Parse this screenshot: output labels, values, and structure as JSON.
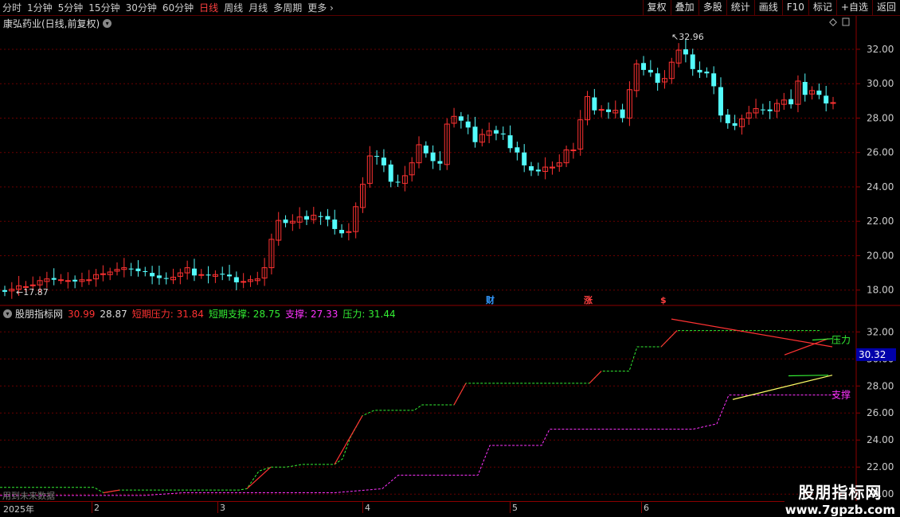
{
  "toolbar": {
    "timeframes": [
      "分时",
      "1分钟",
      "5分钟",
      "15分钟",
      "30分钟",
      "60分钟",
      "日线",
      "周线",
      "月线",
      "多周期",
      "更多"
    ],
    "active_index": 6,
    "right_buttons": [
      "复权",
      "叠加",
      "多股",
      "统计",
      "画线",
      "F10",
      "标记",
      "+自选",
      "返回"
    ]
  },
  "stock": {
    "title": "康弘药业(日线,前复权)"
  },
  "price_chart": {
    "ylabels": [
      "32.00",
      "30.00",
      "28.00",
      "26.00",
      "24.00",
      "22.00",
      "20.00",
      "18.00"
    ],
    "high_label": "32.96",
    "low_label": "17.87",
    "events": [
      "财",
      "涨",
      "$"
    ]
  },
  "indicator": {
    "name": "股朋指标网",
    "v1": "30.99",
    "v2": "28.87",
    "short_resist": "短期压力: 31.84",
    "short_support": "短期支撑: 28.75",
    "support": "支撑: 27.33",
    "resist": "压力: 31.44",
    "ylabels": [
      "32.00",
      "30.00",
      "28.00",
      "26.00",
      "24.00",
      "22.00",
      "20.00"
    ],
    "current": "30.32",
    "label_resist": "压力",
    "label_support": "支撑"
  },
  "dates": [
    "2025年",
    "2",
    "3",
    "4",
    "5",
    "6"
  ],
  "hint": "用到未来数据",
  "watermark": {
    "cn": "股朋指标网",
    "url": "www.7gpzb.com"
  },
  "colors": {
    "up": "#ff3232",
    "down": "#54fcfc",
    "green": "#33ee33",
    "magenta": "#ff33ff",
    "yellow": "#ffff66"
  },
  "chart_data": {
    "type": "candlestick",
    "ohlc_open": [
      18.0,
      17.95,
      18.05,
      18.2,
      18.25,
      18.3,
      18.5,
      18.7,
      18.6,
      18.55,
      18.6,
      18.5,
      18.55,
      18.65,
      18.9,
      18.9,
      19.1,
      19.2,
      19.25,
      19.25,
      19.1,
      19.0,
      18.85,
      18.7,
      18.6,
      18.8,
      19.0,
      19.25,
      18.9,
      18.9,
      18.8,
      18.95,
      18.9,
      18.75,
      18.5,
      18.5,
      18.55,
      18.7,
      19.3,
      20.9,
      22.1,
      21.9,
      21.95,
      22.3,
      22.1,
      22.3,
      22.3,
      22.1,
      21.5,
      21.35,
      21.4,
      22.8,
      24.2,
      25.8,
      25.7,
      25.3,
      24.3,
      24.2,
      24.7,
      25.4,
      26.4,
      26.0,
      25.5,
      25.3,
      27.7,
      28.1,
      27.8,
      27.5,
      26.6,
      27.0,
      27.3,
      27.1,
      27.0,
      26.3,
      26.0,
      25.2,
      25.0,
      24.9,
      25.1,
      25.2,
      25.4,
      26.1,
      26.2,
      27.9,
      29.2,
      28.5,
      28.5,
      28.3,
      28.5,
      28.0,
      29.6,
      31.2,
      30.8,
      30.6,
      30.1,
      30.3,
      31.2,
      32.0,
      31.7,
      30.8,
      30.7,
      30.6,
      29.8,
      28.2,
      27.7,
      27.5,
      28.0,
      28.3,
      28.5,
      28.5,
      28.4,
      28.8,
      29.1,
      28.8,
      30.1,
      29.4,
      29.6,
      29.3,
      28.9
    ]
  }
}
